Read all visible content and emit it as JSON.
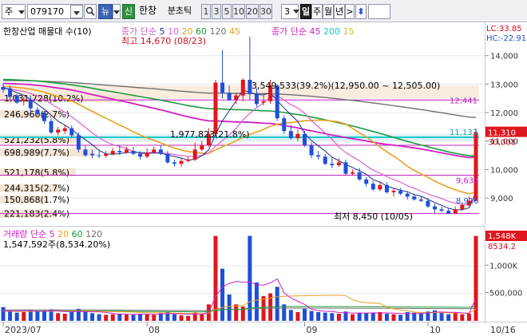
{
  "toolbar": {
    "market": "주",
    "code": "079170",
    "news_btn": "뉴",
    "credit_btn": "신",
    "name": "한창",
    "mode": "분초틱",
    "intervals": [
      "1",
      "3",
      "5",
      "10",
      "20",
      "30"
    ],
    "unit_value": "3",
    "period_day": "일",
    "period_week": "주",
    "period_month": "월",
    "period_year": "년",
    "next": ">",
    "updown": "⬍"
  },
  "colors": {
    "up": "#e0161e",
    "down": "#1f4fd8",
    "ma5": "#1e2a8a",
    "ma10": "#e060d0",
    "ma20": "#e8a020",
    "ma60": "#1a9a3a",
    "ma120": "#707070",
    "ma45": "#d020c0",
    "ma200": "#18c8d0",
    "ma15": "#c8c020"
  },
  "price_legend": {
    "title": "한창산업 매물대 수(10)",
    "ma_prefix": "종가 단순",
    "ma_periods": [
      "5",
      "10",
      "20",
      "60",
      "120",
      "45"
    ],
    "ma2_prefix": "종가 단순",
    "ma2_periods": [
      "45",
      "200",
      "15"
    ]
  },
  "annotations": {
    "high": "최고 14,670 (08/23)",
    "low": "최저 8,450 (10/05)",
    "resistance_label": "3,549,533(39.2%)(12,950.00 ~ 12,505.00)",
    "mid_label": "1,977,823(21.8%)",
    "right_12441": "12,441",
    "right_11133": "11,133",
    "right_9631": "9,631",
    "right_8916": "8,916"
  },
  "volume_profile": [
    {
      "label": "1,031,728(10.2%)",
      "level": 12500
    },
    {
      "label": "246,960(2.7%)",
      "level": 11950
    },
    {
      "label": "521,232(5.8%)",
      "level": 11050
    },
    {
      "label": "698,989(7.7%)",
      "level": 10600
    },
    {
      "label": "521,178(5.8%)",
      "level": 9900
    },
    {
      "label": "244,315(2.7%)",
      "level": 9350
    },
    {
      "label": "150,868(1.7%)",
      "level": 8950
    },
    {
      "label": "221,183(2.4%)",
      "level": 8450
    }
  ],
  "price_axis": {
    "ticks": [
      "14,000",
      "13,000",
      "12,000",
      "11,000",
      "10,000",
      "9,000"
    ],
    "lc": "LC:33.85",
    "hc": "HC:-22.91",
    "current": "11,310",
    "current_sub": "30,001"
  },
  "volume_legend": {
    "title": "거래량 단순",
    "periods": [
      "5",
      "20",
      "60",
      "120"
    ],
    "last": "1,547,592주(8,534.20%)"
  },
  "volume_axis": {
    "ticks": [
      "1,000K",
      "500,000"
    ],
    "current": "1,548K",
    "current_sub": "8534.2"
  },
  "x_axis": {
    "labels": [
      "2023/07",
      "08",
      "09",
      "10",
      "10/16"
    ]
  },
  "chart_data": {
    "type": "candlestick",
    "title": "한창산업",
    "ylim": [
      8000,
      14670
    ],
    "volume_ylim": [
      0,
      1600000
    ],
    "dates": [
      "07/03",
      "07/04",
      "07/05",
      "07/06",
      "07/07",
      "07/10",
      "07/11",
      "07/12",
      "07/13",
      "07/14",
      "07/17",
      "07/18",
      "07/19",
      "07/20",
      "07/21",
      "07/24",
      "07/25",
      "07/26",
      "07/27",
      "07/28",
      "07/31",
      "08/01",
      "08/02",
      "08/03",
      "08/04",
      "08/07",
      "08/08",
      "08/09",
      "08/10",
      "08/11",
      "08/14",
      "08/16",
      "08/17",
      "08/18",
      "08/21",
      "08/22",
      "08/23",
      "08/24",
      "08/25",
      "08/28",
      "08/29",
      "08/30",
      "08/31",
      "09/01",
      "09/04",
      "09/05",
      "09/06",
      "09/07",
      "09/08",
      "09/11",
      "09/12",
      "09/13",
      "09/14",
      "09/15",
      "09/18",
      "09/19",
      "09/20",
      "09/21",
      "09/22",
      "09/25",
      "09/26",
      "09/27",
      "10/04",
      "10/05",
      "10/06",
      "10/10",
      "10/11",
      "10/12",
      "10/13",
      "10/16"
    ],
    "open": [
      12900,
      12850,
      12600,
      12400,
      12450,
      12100,
      12000,
      11700,
      11300,
      11350,
      11450,
      11200,
      10700,
      10550,
      10500,
      10480,
      10550,
      10650,
      10600,
      10650,
      10550,
      10450,
      10600,
      10700,
      10550,
      10250,
      10200,
      10300,
      10350,
      10700,
      10850,
      11250,
      13050,
      12700,
      12450,
      12600,
      13150,
      12650,
      12350,
      12400,
      12950,
      11800,
      11350,
      11100,
      11250,
      10850,
      10500,
      10450,
      10200,
      10150,
      10250,
      9850,
      9900,
      9650,
      9500,
      9300,
      9450,
      9200,
      9250,
      9150,
      9050,
      8950,
      8900,
      8700,
      8600,
      8550,
      8450,
      8600,
      8750,
      8900
    ],
    "high": [
      13050,
      12950,
      12650,
      12550,
      12600,
      12200,
      12050,
      11800,
      11500,
      11550,
      11550,
      11300,
      10850,
      10700,
      10700,
      10650,
      10750,
      10850,
      10800,
      10800,
      10650,
      10750,
      10800,
      10850,
      10650,
      10350,
      10400,
      10450,
      10950,
      11000,
      11450,
      13150,
      14200,
      12950,
      12700,
      13200,
      14670,
      12850,
      12600,
      13150,
      13000,
      11900,
      11550,
      11400,
      11350,
      10950,
      10650,
      10550,
      10450,
      10400,
      10350,
      10000,
      10050,
      9750,
      9600,
      9550,
      9550,
      9350,
      9350,
      9250,
      9150,
      9050,
      9000,
      8800,
      8700,
      8650,
      8700,
      8850,
      9050,
      11450
    ],
    "low": [
      12700,
      12450,
      12300,
      12250,
      12000,
      11900,
      11600,
      11250,
      11200,
      11250,
      11100,
      10600,
      10450,
      10400,
      10400,
      10420,
      10500,
      10500,
      10550,
      10500,
      10350,
      10400,
      10550,
      10500,
      10200,
      10100,
      10100,
      10250,
      10300,
      10650,
      10800,
      11200,
      12500,
      12400,
      12300,
      12400,
      12450,
      12200,
      12250,
      12300,
      11700,
      11250,
      11050,
      11000,
      10800,
      10400,
      10350,
      10150,
      10050,
      10100,
      9800,
      9800,
      9600,
      9400,
      9250,
      9250,
      9150,
      9050,
      9100,
      8950,
      8900,
      8850,
      8650,
      8450,
      8500,
      8500,
      8450,
      8550,
      8700,
      8880
    ],
    "close": [
      12800,
      12550,
      12350,
      12450,
      12150,
      11950,
      11700,
      11300,
      11400,
      11450,
      11200,
      10700,
      10500,
      10500,
      10480,
      10550,
      10650,
      10600,
      10700,
      10550,
      10450,
      10600,
      10700,
      10550,
      10250,
      10200,
      10300,
      10350,
      10700,
      10850,
      11250,
      13050,
      12700,
      12450,
      12600,
      13150,
      12650,
      12300,
      12400,
      12950,
      11800,
      11350,
      11100,
      11250,
      10850,
      10500,
      10450,
      10200,
      10150,
      10250,
      9850,
      9900,
      9650,
      9500,
      9300,
      9450,
      9200,
      9250,
      9150,
      9050,
      8950,
      8900,
      8700,
      8600,
      8550,
      8450,
      8600,
      8750,
      8900,
      11310
    ],
    "volume": [
      250000,
      180000,
      150000,
      160000,
      200000,
      170000,
      190000,
      210000,
      140000,
      130000,
      160000,
      220000,
      180000,
      140000,
      120000,
      110000,
      120000,
      130000,
      120000,
      110000,
      130000,
      120000,
      110000,
      140000,
      160000,
      120000,
      100000,
      90000,
      150000,
      130000,
      300000,
      1548000,
      950000,
      480000,
      300000,
      260000,
      1548000,
      700000,
      450000,
      500000,
      620000,
      300000,
      200000,
      160000,
      220000,
      180000,
      160000,
      150000,
      140000,
      130000,
      170000,
      120000,
      150000,
      140000,
      150000,
      160000,
      130000,
      120000,
      110000,
      160000,
      150000,
      140000,
      170000,
      190000,
      160000,
      120000,
      140000,
      120000,
      130000,
      1547592
    ]
  }
}
